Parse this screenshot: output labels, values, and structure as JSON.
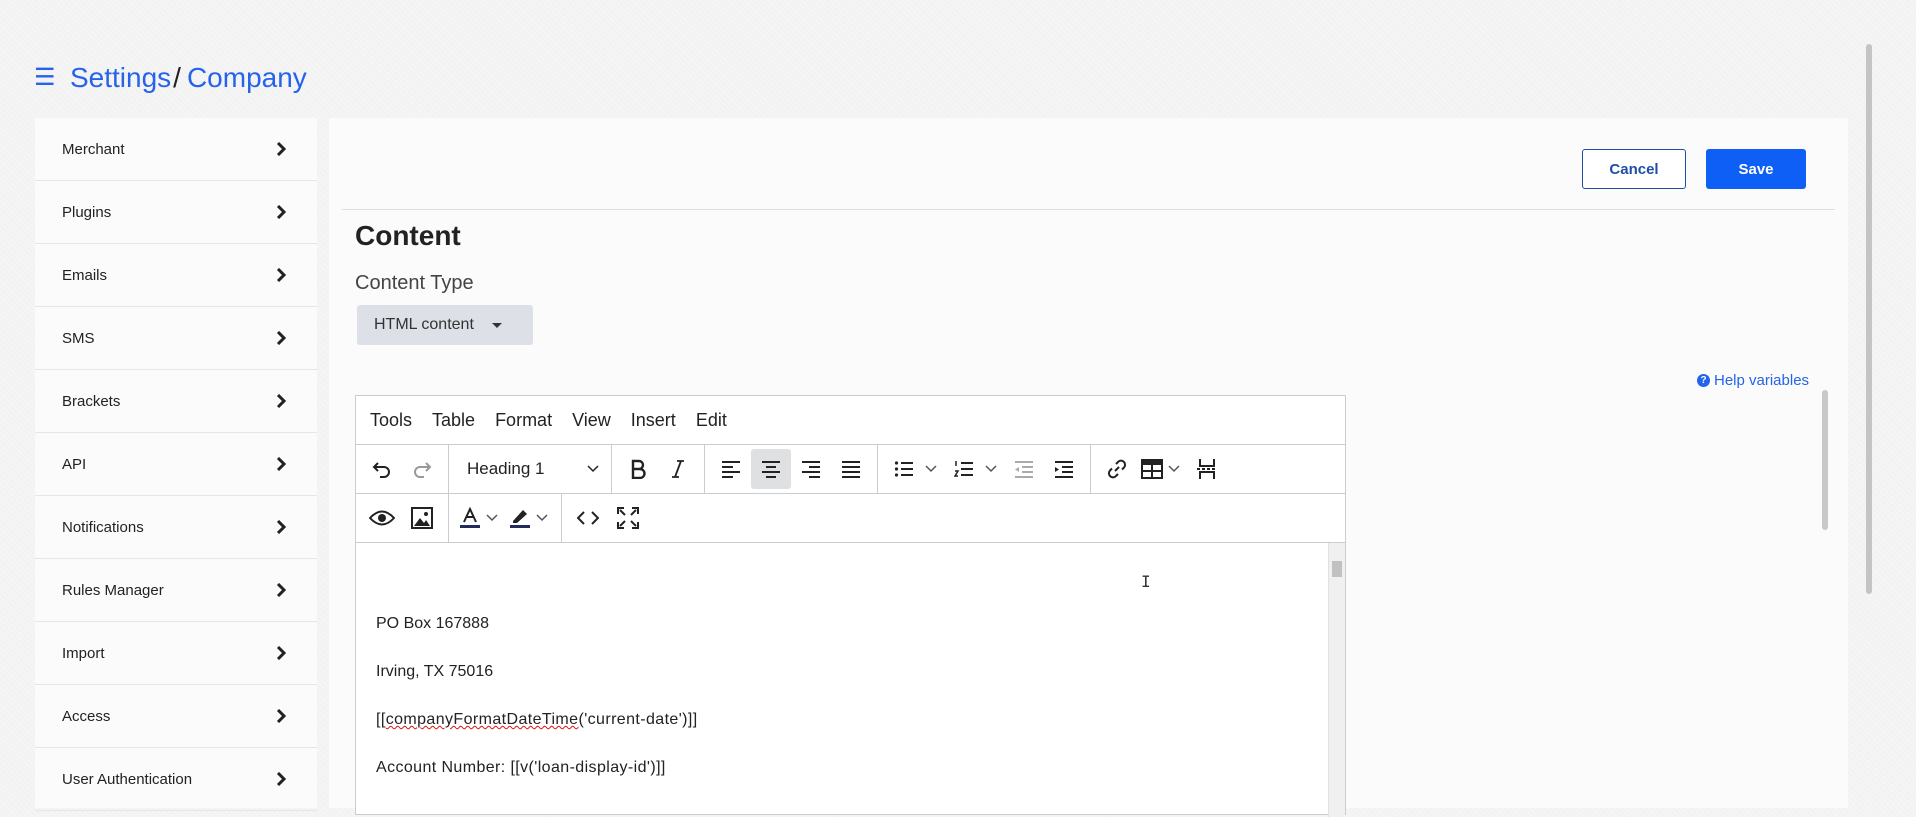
{
  "header": {
    "menu_icon": "hamburger-icon",
    "breadcrumb": [
      "Settings",
      "Company"
    ],
    "separator": "/"
  },
  "sidebar": {
    "items": [
      {
        "label": "Merchant"
      },
      {
        "label": "Plugins"
      },
      {
        "label": "Emails"
      },
      {
        "label": "SMS"
      },
      {
        "label": "Brackets"
      },
      {
        "label": "API"
      },
      {
        "label": "Notifications"
      },
      {
        "label": "Rules Manager"
      },
      {
        "label": "Import"
      },
      {
        "label": "Access"
      },
      {
        "label": "User Authentication"
      }
    ]
  },
  "actions": {
    "cancel_label": "Cancel",
    "save_label": "Save"
  },
  "content": {
    "title": "Content",
    "type_label": "Content Type",
    "type_value": "HTML content",
    "help_label": "Help variables"
  },
  "editor": {
    "menu": [
      "Tools",
      "Table",
      "Format",
      "View",
      "Insert",
      "Edit"
    ],
    "block_format": "Heading 1",
    "toolbar_icons": [
      "undo-icon",
      "redo-icon",
      "bold-icon",
      "italic-icon",
      "align-left-icon",
      "align-center-icon",
      "align-right-icon",
      "align-justify-icon",
      "bullet-list-icon",
      "numbered-list-icon",
      "outdent-icon",
      "indent-icon",
      "link-icon",
      "table-icon",
      "page-break-icon",
      "preview-icon",
      "image-icon",
      "text-color-icon",
      "highlight-icon",
      "source-code-icon",
      "fullscreen-icon"
    ],
    "lines": {
      "po_box": "PO Box 167888",
      "city": "Irving, TX 75016",
      "date_prefix": "[[",
      "date_func": "companyFormatDateTime",
      "date_suffix": "('current-date')]]",
      "account": "Account Number: [[v('loan-display-id')]]"
    }
  },
  "colors": {
    "accent": "#2563eb",
    "save_bg": "#0d5ff5",
    "cancel_border": "#1f4ea8"
  }
}
